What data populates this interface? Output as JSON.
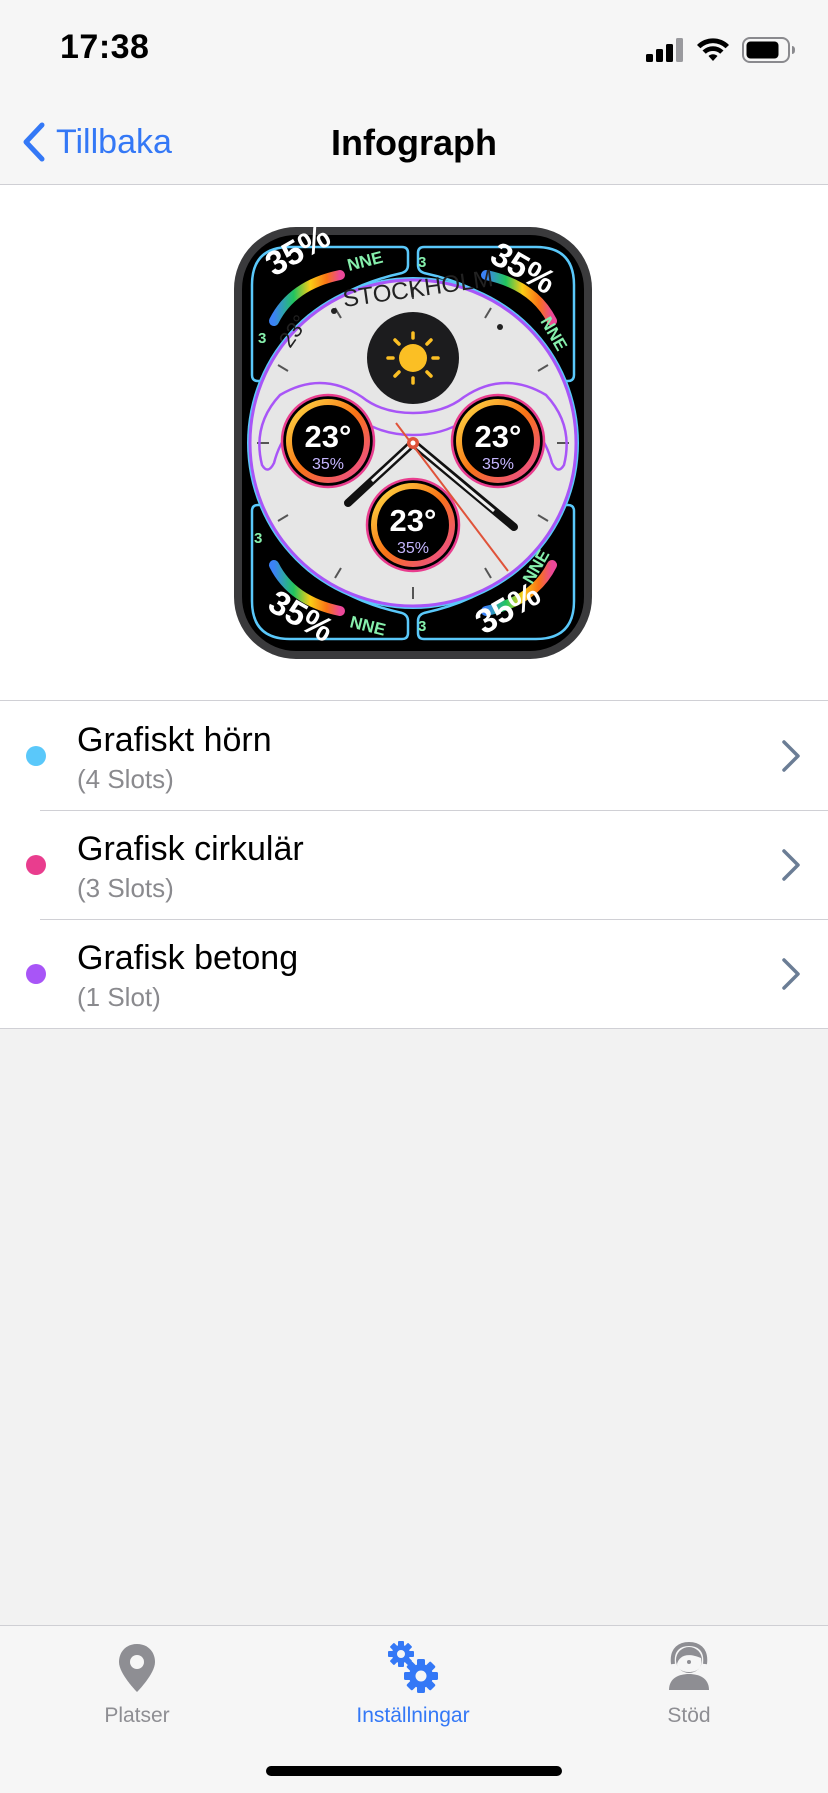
{
  "status": {
    "time": "17:38",
    "icons": [
      "cellular-signal-icon",
      "wifi-icon",
      "battery-icon"
    ]
  },
  "nav": {
    "back_label": "Tillbaka",
    "title": "Infograph"
  },
  "watch_face": {
    "name": "Infograph",
    "corner_value": "35%",
    "corner_direction": "NNE",
    "corner_small": "3",
    "city": "STOCKHOLM",
    "top_temp": "23°",
    "sub_temp": "23°",
    "sub_humidity": "35%",
    "center_icon": "sun-icon"
  },
  "list": {
    "items": [
      {
        "title": "Grafiskt hörn",
        "subtitle": "(4 Slots)",
        "dot_color": "#5ac8fa"
      },
      {
        "title": "Grafisk cirkulär",
        "subtitle": "(3 Slots)",
        "dot_color": "#e93d8e"
      },
      {
        "title": "Grafisk betong",
        "subtitle": "(1 Slot)",
        "dot_color": "#a855f7"
      }
    ]
  },
  "tabbar": {
    "tabs": [
      {
        "label": "Platser",
        "icon": "location-pin-icon",
        "active": false
      },
      {
        "label": "Inställningar",
        "icon": "gears-icon",
        "active": true
      },
      {
        "label": "Stöd",
        "icon": "support-agent-icon",
        "active": false
      }
    ]
  },
  "colors": {
    "accent": "#3478f6",
    "inactive": "#8e8e93",
    "corner_ring": "#5ac8fa",
    "circular_ring": "#e93d8e",
    "bezel_ring": "#a855f7"
  }
}
